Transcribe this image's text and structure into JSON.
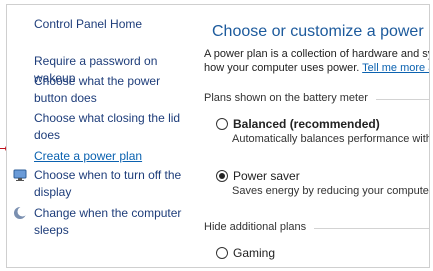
{
  "nav": {
    "home": "Control Panel Home",
    "items": [
      {
        "label": "Require a password on wakeup"
      },
      {
        "label": "Choose what the power button does"
      },
      {
        "label": "Choose what closing the lid does"
      },
      {
        "label": "Create a power plan"
      },
      {
        "label": "Choose when to turn off the display",
        "icon": "display-icon"
      },
      {
        "label": "Change when the computer sleeps",
        "icon": "moon-icon"
      }
    ]
  },
  "main": {
    "title": "Choose or customize a power plan",
    "description_line1": "A power plan is a collection of hardware and sy",
    "description_line2_prefix": "how your computer uses power. ",
    "tell_me_more": "Tell me more a",
    "battery_meter_heading": "Plans shown on the battery meter",
    "plans": [
      {
        "name": "Balanced (recommended)",
        "description": "Automatically balances performance with",
        "selected": false
      },
      {
        "name": "Power saver",
        "description": "Saves energy by reducing your computer",
        "selected": true
      }
    ],
    "hide_heading": "Hide additional plans",
    "hidden_plans": [
      {
        "name": "Gaming",
        "selected": false
      }
    ]
  },
  "colors": {
    "title": "#1c5a9c",
    "link": "#0b62b0",
    "pointer": "#c0101c"
  }
}
